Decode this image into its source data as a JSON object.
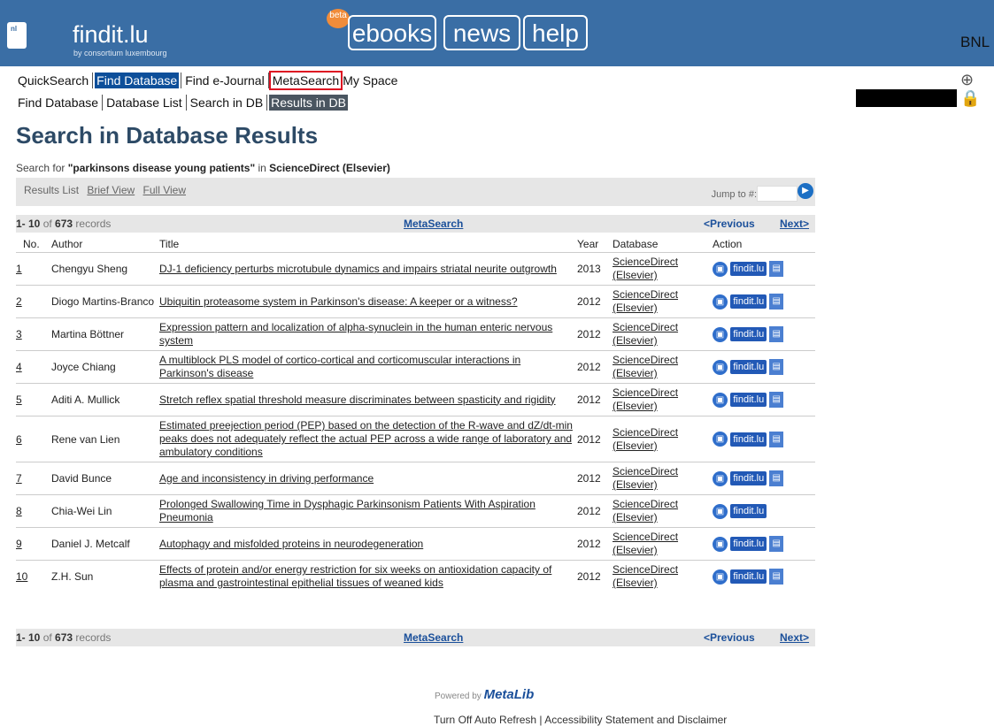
{
  "topbar": {
    "badge": "nl",
    "brand": "findit.lu",
    "brand_sub": "by consortium luxembourg",
    "beta": "beta",
    "nav": [
      "ebooks",
      "news",
      "help"
    ],
    "right_label": "BNL"
  },
  "menu1": {
    "items": [
      "QuickSearch",
      "Find Database",
      "Find e-Journal",
      "MetaSearch",
      "My Space"
    ]
  },
  "menu2": {
    "items": [
      "Find Database",
      "Database List",
      "Search in DB",
      "Results in DB"
    ]
  },
  "page_title": "Search in Database Results",
  "search": {
    "prefix": "Search for ",
    "query": "\"parkinsons disease young patients\"",
    "middle": " in ",
    "db": "ScienceDirect (Elsevier)"
  },
  "views": {
    "label": "Results List",
    "brief": "Brief View",
    "full": "Full View",
    "jump_label": "Jump to #:"
  },
  "pager": {
    "range": "1- 10",
    "of": " of ",
    "total": "673",
    "records": " records",
    "meta_link": "MetaSearch",
    "prev": "<Previous",
    "next": "Next>"
  },
  "columns": {
    "no": "No.",
    "author": "Author",
    "title": "Title",
    "year": "Year",
    "database": "Database",
    "action": "Action"
  },
  "rows": [
    {
      "no": "1",
      "author": "Chengyu Sheng",
      "title": "DJ-1 deficiency perturbs microtubule dynamics and impairs striatal neurite outgrowth",
      "year": "2013",
      "db1": "ScienceDirect",
      "db2": "(Elsevier)"
    },
    {
      "no": "2",
      "author": "Diogo Martins-Branco",
      "title": "Ubiquitin proteasome system in Parkinson's disease: A keeper or a witness?",
      "year": "2012",
      "db1": "ScienceDirect",
      "db2": "(Elsevier)"
    },
    {
      "no": "3",
      "author": "Martina Böttner",
      "title": "Expression pattern and localization of alpha-synuclein in the human enteric nervous system",
      "year": "2012",
      "db1": "ScienceDirect",
      "db2": "(Elsevier)"
    },
    {
      "no": "4",
      "author": "Joyce Chiang",
      "title": "A multiblock PLS model of cortico-cortical and corticomuscular interactions in Parkinson's disease",
      "year": "2012",
      "db1": "ScienceDirect",
      "db2": "(Elsevier)"
    },
    {
      "no": "5",
      "author": "Aditi A. Mullick",
      "title": "Stretch reflex spatial threshold measure discriminates between spasticity and rigidity",
      "year": "2012",
      "db1": "ScienceDirect",
      "db2": "(Elsevier)"
    },
    {
      "no": "6",
      "author": "Rene van Lien",
      "title": "Estimated preejection period (PEP) based on the detection of the R-wave and dZ/dt-min peaks does not adequately reflect the actual PEP across a wide range of laboratory and ambulatory conditions",
      "year": "2012",
      "db1": "ScienceDirect",
      "db2": "(Elsevier)"
    },
    {
      "no": "7",
      "author": "David Bunce",
      "title": "Age and inconsistency in driving performance",
      "year": "2012",
      "db1": "ScienceDirect",
      "db2": "(Elsevier)"
    },
    {
      "no": "8",
      "author": "Chia-Wei Lin",
      "title": "Prolonged Swallowing Time in Dysphagic Parkinsonism Patients With Aspiration Pneumonia",
      "year": "2012",
      "db1": "ScienceDirect",
      "db2": "(Elsevier)"
    },
    {
      "no": "9",
      "author": "Daniel J. Metcalf",
      "title": "Autophagy and misfolded proteins in neurodegeneration",
      "year": "2012",
      "db1": "ScienceDirect",
      "db2": "(Elsevier)"
    },
    {
      "no": "10",
      "author": "Z.H. Sun",
      "title": "Effects of protein and/or energy restriction for six weeks on antioxidation capacity of plasma and gastrointestinal epithelial tissues of weaned kids",
      "year": "2012",
      "db1": "ScienceDirect",
      "db2": "(Elsevier)"
    }
  ],
  "action": {
    "findit": "findit.lu"
  },
  "footer": {
    "powered": "Powered by ",
    "metalib": "MetaLib",
    "autorefresh": "Turn Off Auto Refresh",
    "sep": "|",
    "access": "Accessibility Statement and Disclaimer"
  }
}
